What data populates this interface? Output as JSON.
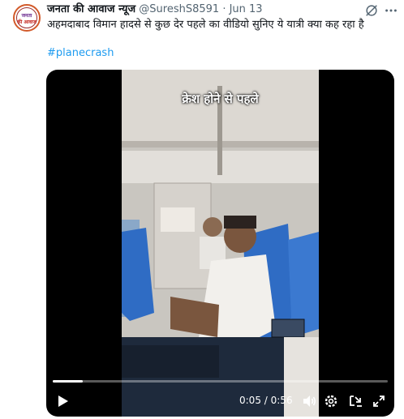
{
  "tweet": {
    "author": "जनता की आवाज न्यूज",
    "handle": "@SureshS8591",
    "separator": "·",
    "date": "Jun 13",
    "text": "अहमदाबाद विमान हादसे से कुछ देर पहले का वीडियो सुनिए ये यात्री क्या कह रहा है",
    "hashtag": "#planecrash",
    "avatar": {
      "line1": "जनता",
      "line2": "की आवाज"
    }
  },
  "video": {
    "overlay_title": "क्रेश होने से पहले",
    "current_time": "0:05",
    "duration": "0:56",
    "time_separator": " / ",
    "progress_fraction": 0.089
  },
  "icons": {
    "grok": "grok-icon",
    "more": "more-icon",
    "play": "play-icon",
    "volume": "volume-icon",
    "settings": "gear-icon",
    "pip": "picture-in-picture-icon",
    "fullscreen": "fullscreen-icon"
  },
  "colors": {
    "link": "#1d9bf0",
    "secondary_text": "#536471",
    "seat_blue": "#2f6cc4"
  }
}
